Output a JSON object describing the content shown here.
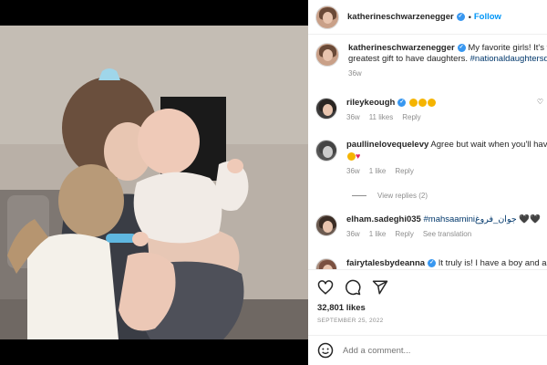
{
  "post": {
    "author": "katherineschwarzenegger",
    "follow_label": "Follow",
    "dot": "•"
  },
  "caption": {
    "username": "katherineschwarzenegger",
    "text": "My favorite girls! It's the",
    "text_line2": "greatest gift to have daughters.",
    "hashtag": "#nationaldaughtersday",
    "time": "36w"
  },
  "comments": [
    {
      "username": "rileykeough",
      "text": "",
      "emojis": [
        "#f5b400",
        "#f5b400",
        "#f5b400"
      ],
      "time": "36w",
      "likes": "11 likes",
      "reply": "Reply"
    },
    {
      "username": "paullinelovequelevy",
      "text": "Agree but wait when you'll have",
      "emojis_line2": [
        "#f5b400",
        "#e0245e"
      ],
      "time": "36w",
      "likes": "1 like",
      "reply": "Reply",
      "view_replies": "View replies (2)"
    },
    {
      "username": "elham.sadeghi035",
      "text": "#mahsaaminiجوان_فروغ",
      "text_suffix": "🖤🖤",
      "time": "36w",
      "likes": "1 like",
      "reply": "Reply",
      "see_translation": "See translation"
    },
    {
      "username": "fairytalesbydeanna",
      "text": "It truly is! I have a boy and a"
    }
  ],
  "stats": {
    "likes": "32,801 likes",
    "date": "SEPTEMBER 25, 2022"
  },
  "composer": {
    "placeholder": "Add a comment..."
  },
  "icons": [
    "heart-icon",
    "comment-icon",
    "share-icon",
    "emoji-icon",
    "verified-badge-icon"
  ],
  "colors": {
    "accent": "#0095f6",
    "verified": "#3897f0",
    "muted": "#8e8e8e",
    "text": "#262626"
  }
}
